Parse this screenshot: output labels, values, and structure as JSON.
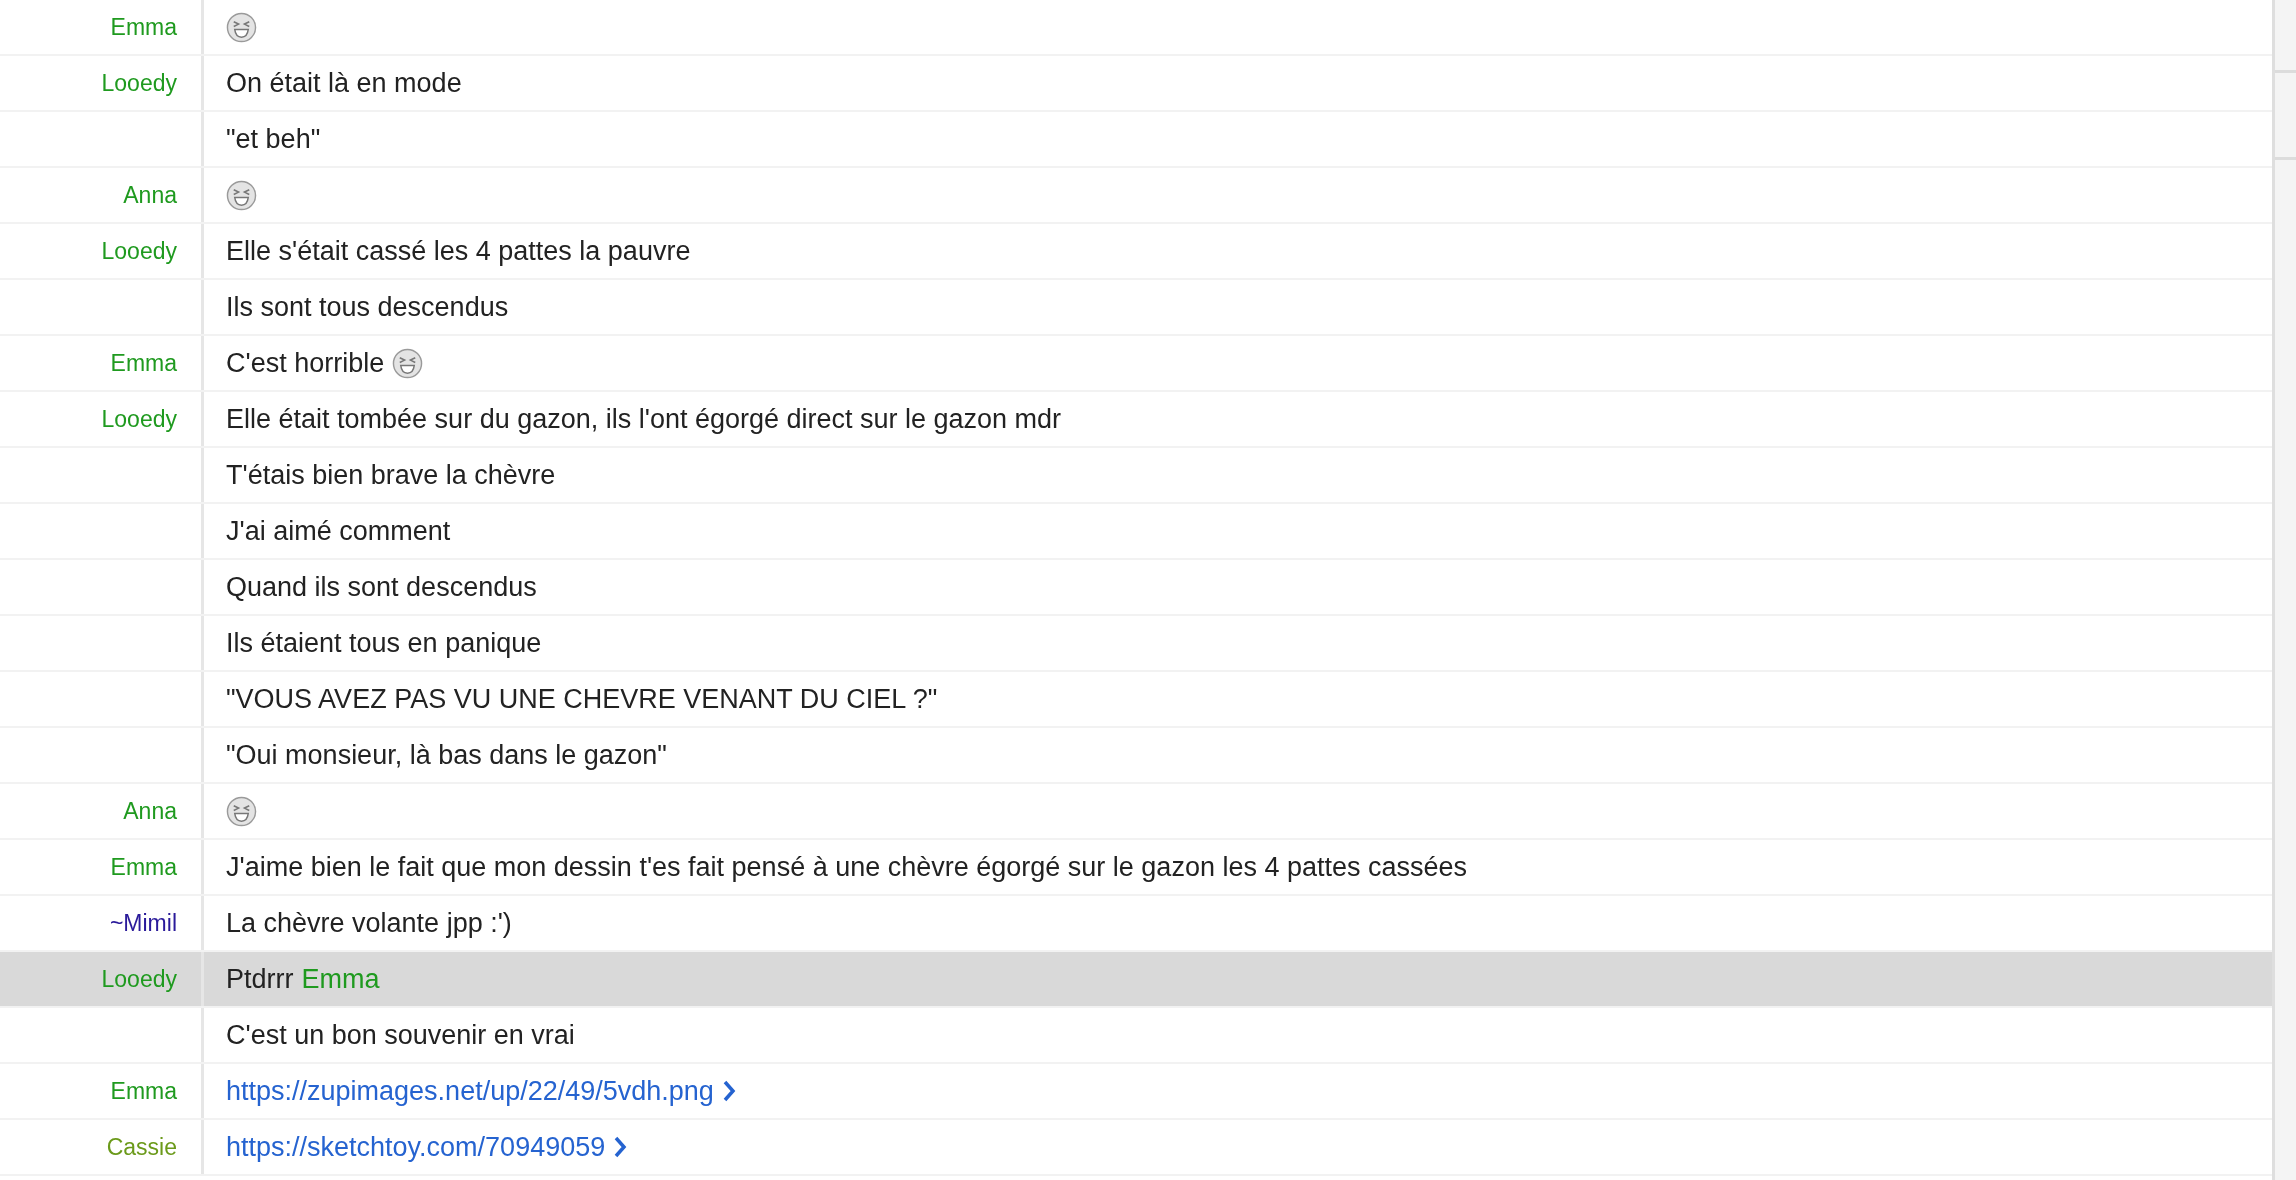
{
  "messages": [
    {
      "author": "Emma",
      "color": "#1f9a1f",
      "selected": false,
      "parts": [
        {
          "kind": "emoji"
        }
      ]
    },
    {
      "author": "Looedy",
      "color": "#1f9a1f",
      "selected": false,
      "parts": [
        {
          "kind": "text",
          "text": "On était là en mode"
        }
      ]
    },
    {
      "selected": false,
      "parts": [
        {
          "kind": "text",
          "text": "\"et beh\""
        }
      ]
    },
    {
      "author": "Anna",
      "color": "#1f9a1f",
      "selected": false,
      "parts": [
        {
          "kind": "emoji"
        }
      ]
    },
    {
      "author": "Looedy",
      "color": "#1f9a1f",
      "selected": false,
      "parts": [
        {
          "kind": "text",
          "text": "Elle s'était cassé les 4 pattes la pauvre"
        }
      ]
    },
    {
      "selected": false,
      "parts": [
        {
          "kind": "text",
          "text": "Ils sont tous descendus"
        }
      ]
    },
    {
      "author": "Emma",
      "color": "#1f9a1f",
      "selected": false,
      "parts": [
        {
          "kind": "text",
          "text": "C'est horrible"
        },
        {
          "kind": "emoji"
        }
      ]
    },
    {
      "author": "Looedy",
      "color": "#1f9a1f",
      "selected": false,
      "parts": [
        {
          "kind": "text",
          "text": "Elle était tombée sur du gazon, ils l'ont égorgé direct sur le gazon mdr"
        }
      ]
    },
    {
      "selected": false,
      "parts": [
        {
          "kind": "text",
          "text": "T'étais bien brave la chèvre"
        }
      ]
    },
    {
      "selected": false,
      "parts": [
        {
          "kind": "text",
          "text": "J'ai aimé comment"
        }
      ]
    },
    {
      "selected": false,
      "parts": [
        {
          "kind": "text",
          "text": "Quand ils sont descendus"
        }
      ]
    },
    {
      "selected": false,
      "parts": [
        {
          "kind": "text",
          "text": "Ils étaient tous en panique"
        }
      ]
    },
    {
      "selected": false,
      "parts": [
        {
          "kind": "text",
          "text": "\"VOUS AVEZ PAS VU UNE CHEVRE VENANT DU CIEL ?\""
        }
      ]
    },
    {
      "selected": false,
      "parts": [
        {
          "kind": "text",
          "text": "\"Oui monsieur, là bas dans le gazon\""
        }
      ]
    },
    {
      "author": "Anna",
      "color": "#1f9a1f",
      "selected": false,
      "parts": [
        {
          "kind": "emoji"
        }
      ]
    },
    {
      "author": "Emma",
      "color": "#1f9a1f",
      "selected": false,
      "parts": [
        {
          "kind": "text",
          "text": "J'aime bien le fait que mon dessin t'es fait pensé à une chèvre égorgé sur le gazon les 4 pattes cassées"
        }
      ]
    },
    {
      "author": "~Mimil",
      "color": "#2a1a9a",
      "selected": false,
      "parts": [
        {
          "kind": "text",
          "text": "La chèvre volante jpp :')"
        }
      ]
    },
    {
      "author": "Looedy",
      "color": "#1f9a1f",
      "selected": true,
      "parts": [
        {
          "kind": "text",
          "text": "Ptdrrr"
        },
        {
          "kind": "mention",
          "text": "Emma",
          "color": "#1f9a1f"
        }
      ]
    },
    {
      "selected": false,
      "parts": [
        {
          "kind": "text",
          "text": "C'est un bon souvenir en vrai"
        }
      ]
    },
    {
      "author": "Emma",
      "color": "#1f9a1f",
      "selected": false,
      "parts": [
        {
          "kind": "link",
          "text": "https://zupimages.net/up/22/49/5vdh.png"
        }
      ]
    },
    {
      "author": "Cassie",
      "color": "#6b9a1a",
      "selected": false,
      "parts": [
        {
          "kind": "link",
          "text": "https://sketchtoy.com/70949059"
        }
      ]
    }
  ]
}
